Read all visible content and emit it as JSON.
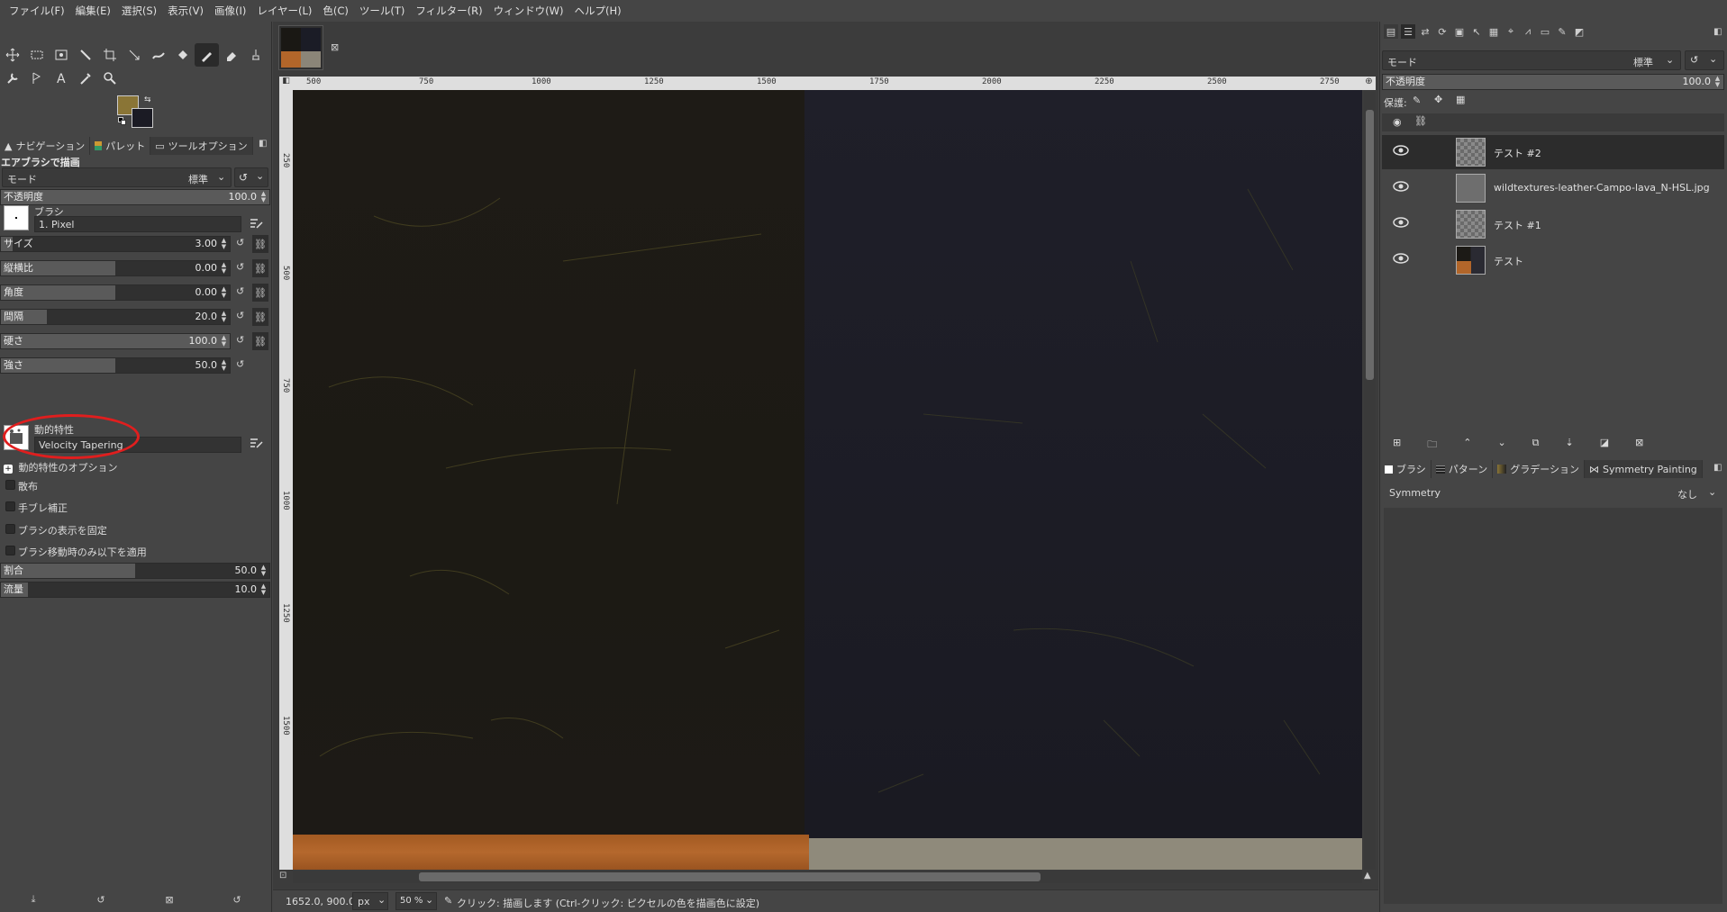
{
  "menubar": [
    "ファイル(F)",
    "編集(E)",
    "選択(S)",
    "表示(V)",
    "画像(I)",
    "レイヤー(L)",
    "色(C)",
    "ツール(T)",
    "フィルター(R)",
    "ウィンドウ(W)",
    "ヘルプ(H)"
  ],
  "colors": {
    "foreground": "#8a7536",
    "background": "#1b1b24",
    "highlight_ring": "#e01e1e"
  },
  "left_tabs": [
    "ナビゲーション",
    "パレット",
    "ツールオプション"
  ],
  "tool_options": {
    "title": "エアブラシで描画",
    "mode_label": "モード",
    "mode_value": "標準",
    "opacity_label": "不透明度",
    "opacity_value": "100.0",
    "brush_label": "ブラシ",
    "brush_value": "1. Pixel",
    "sliders": [
      {
        "label": "サイズ",
        "value": "3.00",
        "fill": 0.05
      },
      {
        "label": "縦横比",
        "value": "0.00",
        "fill": 0.5
      },
      {
        "label": "角度",
        "value": "0.00",
        "fill": 0.5
      },
      {
        "label": "間隔",
        "value": "20.0",
        "fill": 0.2
      },
      {
        "label": "硬さ",
        "value": "100.0",
        "fill": 1.0
      },
      {
        "label": "強さ",
        "value": "50.0",
        "fill": 0.5
      }
    ],
    "dynamics_label": "動的特性",
    "dynamics_value": "Velocity Tapering",
    "dynamics_options": "動的特性のオプション",
    "checks": [
      "散布",
      "手ブレ補正",
      "ブラシの表示を固定",
      "ブラシ移動時のみ以下を適用"
    ],
    "rate_label": "割合",
    "rate_value": "50.0",
    "rate_fill": 0.5,
    "flow_label": "流量",
    "flow_value": "10.0",
    "flow_fill": 0.1
  },
  "rulers": {
    "h": [
      "500",
      "750",
      "1000",
      "1250",
      "1500",
      "1750",
      "2000",
      "2250",
      "2500",
      "2750"
    ],
    "v": [
      "250",
      "500",
      "750",
      "1000",
      "1250",
      "1500"
    ]
  },
  "status": {
    "coords": "1652.0, 900.0",
    "unit": "px",
    "zoom": "50 %",
    "message": "クリック: 描画します (Ctrl-クリック: ピクセルの色を描画色に設定)"
  },
  "layers_panel": {
    "mode_label": "モード",
    "mode_value": "標準",
    "opacity_label": "不透明度",
    "opacity_value": "100.0",
    "lock_label": "保護:",
    "layers": [
      {
        "name": "テスト #2",
        "selected": true
      },
      {
        "name": "wildtextures-leather-Campo-lava_N-HSL.jpg",
        "selected": false
      },
      {
        "name": "テスト #1",
        "selected": false
      },
      {
        "name": "テスト",
        "selected": false
      }
    ]
  },
  "bottom_tabs": [
    "ブラシ",
    "パターン",
    "グラデーション",
    "Symmetry Painting"
  ],
  "symmetry": {
    "label": "Symmetry",
    "value": "なし"
  }
}
